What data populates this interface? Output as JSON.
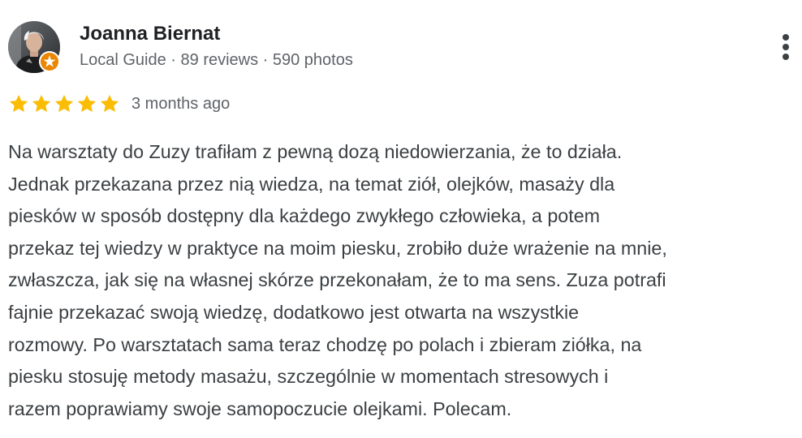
{
  "review": {
    "author": {
      "name": "Joanna Biernat",
      "meta": "Local Guide · 89 reviews · 590 photos",
      "avatar_icon": "user-avatar-photo",
      "badge_icon": "local-guide-star-icon",
      "badge_color": "#ea8600"
    },
    "more_icon": "more-vert-icon",
    "rating": {
      "stars": 5,
      "max": 5,
      "star_color": "#fbbc04"
    },
    "date": "3 months ago",
    "text_lines": [
      "Na warsztaty do Zuzy trafiłam z pewną dozą niedowierzania, że to działa.",
      "Jednak przekazana przez nią wiedza, na temat ziół, olejków, masaży dla",
      "piesków w sposób dostępny dla każdego zwykłego człowieka, a potem",
      "przekaz tej wiedzy w praktyce na moim piesku, zrobiło duże wrażenie na mnie,",
      "zwłaszcza, jak się na własnej skórze przekonałam, że to ma sens. Zuza potrafi",
      "fajnie przekazać swoją wiedzę, dodatkowo jest otwarta na wszystkie",
      "rozmowy. Po warsztatach sama teraz chodzę po polach i zbieram ziółka, na",
      "piesku stosuję metody masażu, szczególnie w momentach stresowych i",
      "razem poprawiamy swoje samopoczucie olejkami. Polecam."
    ]
  }
}
